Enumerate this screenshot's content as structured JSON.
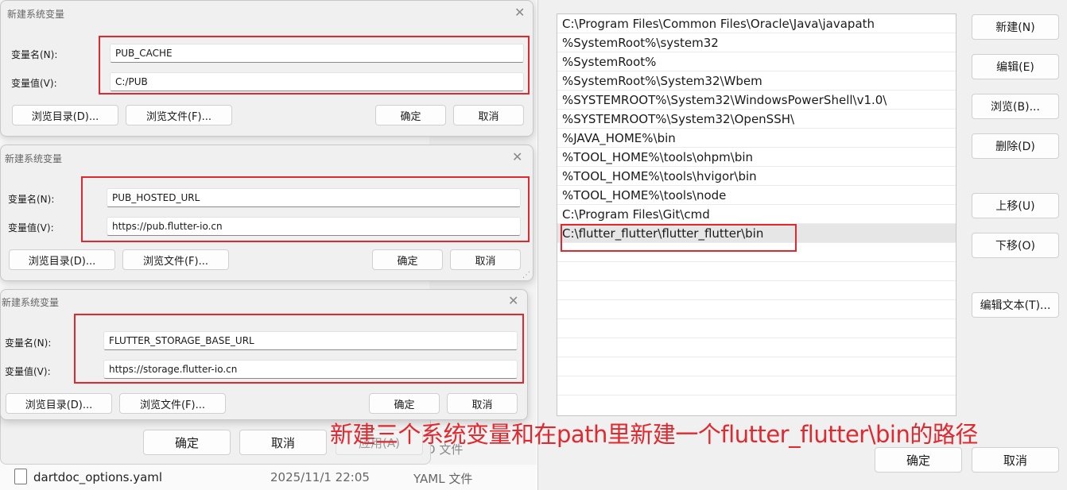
{
  "explorer": {
    "file_name": "dartdoc_options.yaml",
    "file_date": "2025/11/1 22:05",
    "file_type": "YAML 文件",
    "partial_type": "D 文件"
  },
  "env_dialog": {
    "ok": "确定",
    "cancel": "取消",
    "apply": "应用(A)"
  },
  "new_var_dialogs": [
    {
      "title": "新建系统变量",
      "name_label": "变量名(N):",
      "value_label": "变量值(V):",
      "name_value": "PUB_CACHE",
      "value_value": "C:/PUB",
      "browse_dir": "浏览目录(D)...",
      "browse_file": "浏览文件(F)...",
      "ok": "确定",
      "cancel": "取消"
    },
    {
      "title": "新建系统变量",
      "name_label": "变量名(N):",
      "value_label": "变量值(V):",
      "name_value": "PUB_HOSTED_URL",
      "value_value": "https://pub.flutter-io.cn",
      "browse_dir": "浏览目录(D)...",
      "browse_file": "浏览文件(F)...",
      "ok": "确定",
      "cancel": "取消"
    },
    {
      "title": "新建系统变量",
      "name_label": "变量名(N):",
      "value_label": "变量值(V):",
      "name_value": "FLUTTER_STORAGE_BASE_URL",
      "value_value": "https://storage.flutter-io.cn",
      "browse_dir": "浏览目录(D)...",
      "browse_file": "浏览文件(F)...",
      "ok": "确定",
      "cancel": "取消"
    }
  ],
  "path_dialog": {
    "entries": [
      "C:\\Program Files\\Common Files\\Oracle\\Java\\javapath",
      "%SystemRoot%\\system32",
      "%SystemRoot%",
      "%SystemRoot%\\System32\\Wbem",
      "%SYSTEMROOT%\\System32\\WindowsPowerShell\\v1.0\\",
      "%SYSTEMROOT%\\System32\\OpenSSH\\",
      "%JAVA_HOME%\\bin",
      "%TOOL_HOME%\\tools\\ohpm\\bin",
      "%TOOL_HOME%\\tools\\hvigor\\bin",
      "%TOOL_HOME%\\tools\\node",
      "C:\\Program Files\\Git\\cmd",
      "C:\\flutter_flutter\\flutter_flutter\\bin"
    ],
    "buttons": {
      "new": "新建(N)",
      "edit": "编辑(E)",
      "browse": "浏览(B)...",
      "delete": "删除(D)",
      "move_up": "上移(U)",
      "move_down": "下移(O)",
      "edit_text": "编辑文本(T)..."
    },
    "ok": "确定",
    "cancel": "取消"
  },
  "annotation": "新建三个系统变量和在path里新建一个flutter_flutter\\bin的路径",
  "colors": {
    "highlight_red": "#e0282e"
  }
}
